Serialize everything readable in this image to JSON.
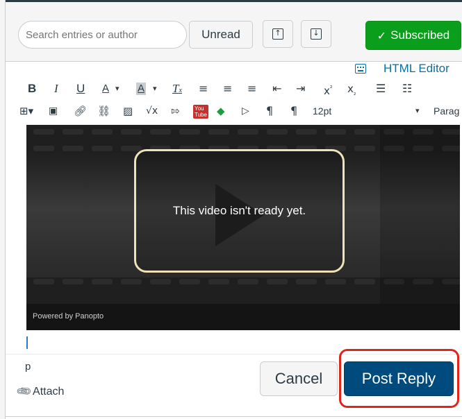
{
  "toolbar": {
    "search_placeholder": "Search entries or author",
    "unread_label": "Unread",
    "subscribed_label": "Subscribed",
    "subscribed_color": "#0b9e1d"
  },
  "editor": {
    "html_editor_label": "HTML Editor",
    "font_size": "12pt",
    "block_format": "Parag",
    "row1_icons": [
      "bold-icon",
      "italic-icon",
      "underline-icon",
      "text-color-icon",
      "background-color-icon",
      "clear-formatting-icon",
      "align-left-icon",
      "align-center-icon",
      "align-right-icon",
      "outdent-icon",
      "indent-icon",
      "superscript-icon",
      "subscript-icon",
      "bullet-list-icon",
      "numbered-list-icon"
    ],
    "row2_icons": [
      "table-icon",
      "media-icon",
      "link-icon",
      "unlink-icon",
      "image-icon",
      "equation-icon",
      "lti-tool-icon",
      "youtube-icon",
      "google-drive-icon",
      "video-embed-icon",
      "ltr-paragraph-icon",
      "rtl-paragraph-icon"
    ],
    "status_path": "p"
  },
  "video": {
    "message": "This video isn't ready yet.",
    "powered_by": "Powered by Panopto"
  },
  "actions": {
    "attach_label": "Attach",
    "cancel_label": "Cancel",
    "post_reply_label": "Post Reply",
    "post_reply_color": "#004b7d",
    "highlight_color": "#e0251b"
  }
}
